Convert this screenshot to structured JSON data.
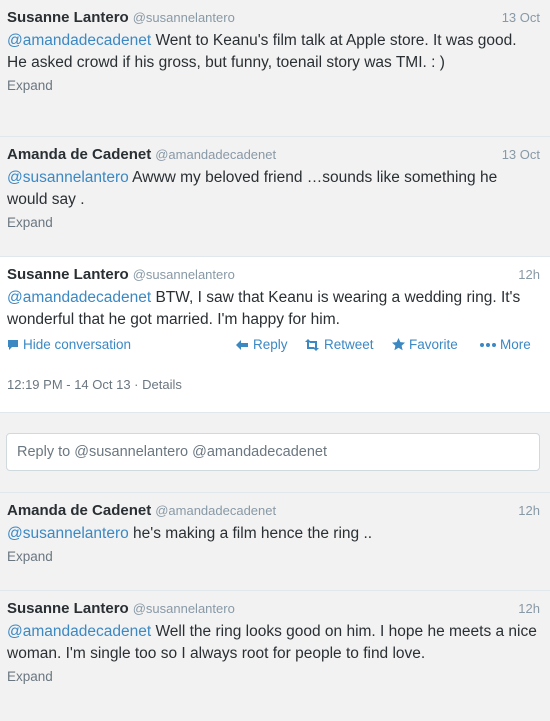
{
  "tweets": [
    {
      "fullname": "Susanne Lantero",
      "username": "@susannelantero",
      "time": "13 Oct",
      "mention": "@amandadecadenet",
      "text": " Went to Keanu's film talk at Apple store. It was good. He asked crowd if his gross, but funny, toenail story was TMI. : )",
      "expand": "Expand"
    },
    {
      "fullname": "Amanda de Cadenet",
      "username": "@amandadecadenet",
      "time": "13 Oct",
      "mention": "@susannelantero",
      "text": " Awww my beloved friend …sounds like something he would say .",
      "expand": "Expand"
    },
    {
      "fullname": "Susanne Lantero",
      "username": "@susannelantero",
      "time": "12h",
      "mention": "@amandadecadenet",
      "text": " BTW, I saw that Keanu is wearing a wedding ring. It's wonderful that he got married. I'm happy for him.",
      "actions": {
        "hide": "Hide conversation",
        "reply": "Reply",
        "retweet": "Retweet",
        "favorite": "Favorite",
        "more": "More"
      },
      "meta": "12:19 PM - 14 Oct 13 · Details"
    },
    {
      "fullname": "Amanda de Cadenet",
      "username": "@amandadecadenet",
      "time": "12h",
      "mention": "@susannelantero",
      "text": " he's making a film hence the ring ..",
      "expand": "Expand"
    },
    {
      "fullname": "Susanne Lantero",
      "username": "@susannelantero",
      "time": "12h",
      "mention": "@amandadecadenet",
      "text": " Well the ring looks good on him.  I hope he meets a nice woman. I'm single too so I always root for people to find love.",
      "expand": "Expand"
    }
  ],
  "reply_box": {
    "placeholder": "Reply to @susannelantero @amandadecadenet"
  },
  "colors": {
    "link": "#3b88c3",
    "muted": "#8899a6",
    "tweet_bg": "#f2f2f2",
    "focused_bg": "#ffffff"
  },
  "icons": [
    "speech-bubble-icon",
    "reply-arrow-icon",
    "retweet-icon",
    "star-icon",
    "more-dots-icon"
  ]
}
